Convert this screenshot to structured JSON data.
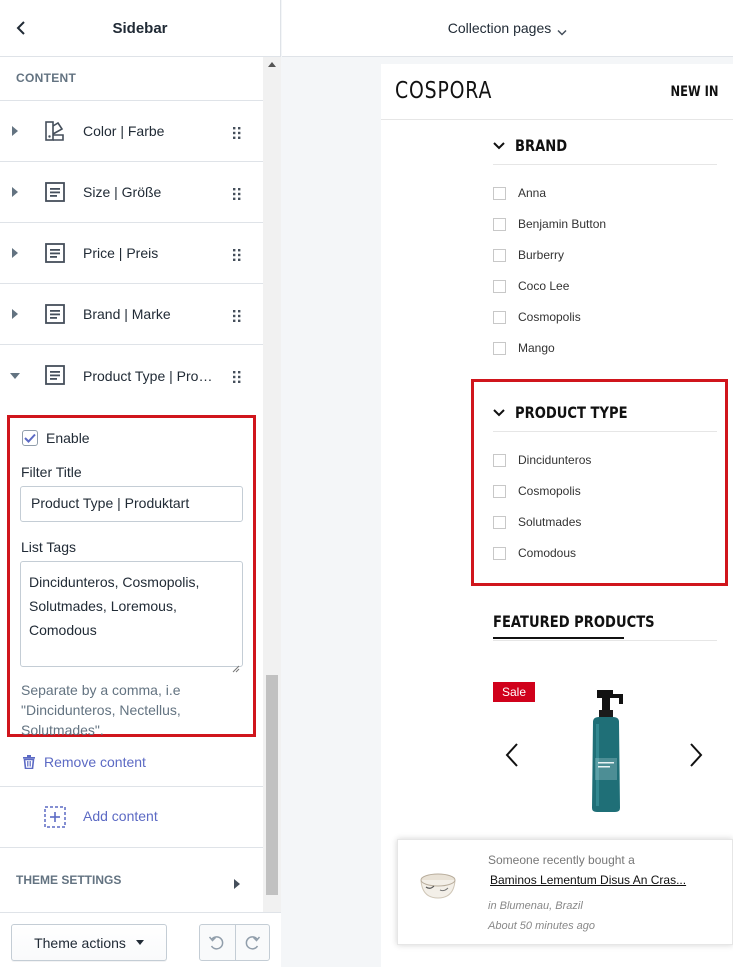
{
  "sidebar": {
    "title": "Sidebar",
    "section_label": "CONTENT",
    "blocks": [
      {
        "label": "Color | Farbe",
        "icon": "color-swatch-icon"
      },
      {
        "label": "Size | Größe",
        "icon": "text-block-icon"
      },
      {
        "label": "Price | Preis",
        "icon": "text-block-icon"
      },
      {
        "label": "Brand | Marke",
        "icon": "text-block-icon"
      },
      {
        "label": "Product Type | Produktart",
        "icon": "text-block-icon"
      }
    ],
    "settings": {
      "enable_label": "Enable",
      "enabled": true,
      "filter_title_label": "Filter Title",
      "filter_title_value": "Product Type | Produktart",
      "list_tags_label": "List Tags",
      "list_tags_value": "Dincidunteros, Cosmopolis, Solutmades, Loremous, Comodous",
      "help_text": "Separate by a comma, i.e \"Dincidunteros, Nectellus, Solutmades\"."
    },
    "remove_content": "Remove content",
    "add_content": "Add content",
    "theme_settings": "THEME SETTINGS",
    "theme_actions": "Theme actions"
  },
  "topbar": {
    "page_selector": "Collection pages"
  },
  "preview": {
    "logo": "COSPORA",
    "nav_new": "NEW IN",
    "brand": {
      "title": "BRAND",
      "options": [
        "Anna",
        "Benjamin Button",
        "Burberry",
        "Coco Lee",
        "Cosmopolis",
        "Mango"
      ]
    },
    "product_type": {
      "title": "PRODUCT TYPE",
      "options": [
        "Dincidunteros",
        "Cosmopolis",
        "Solutmades",
        "Comodous"
      ]
    },
    "featured": {
      "title": "FEATURED PRODUCTS",
      "sale_badge": "Sale"
    },
    "recent_purchase": {
      "line1": "Someone recently bought a",
      "product": "Baminos Lementum Disus An Cras...",
      "location": "in Blumenau, Brazil",
      "time": "About 50 minutes ago"
    }
  },
  "colors": {
    "highlight": "#d0151c",
    "link": "#5c6ac4",
    "sale": "#d0011b"
  }
}
